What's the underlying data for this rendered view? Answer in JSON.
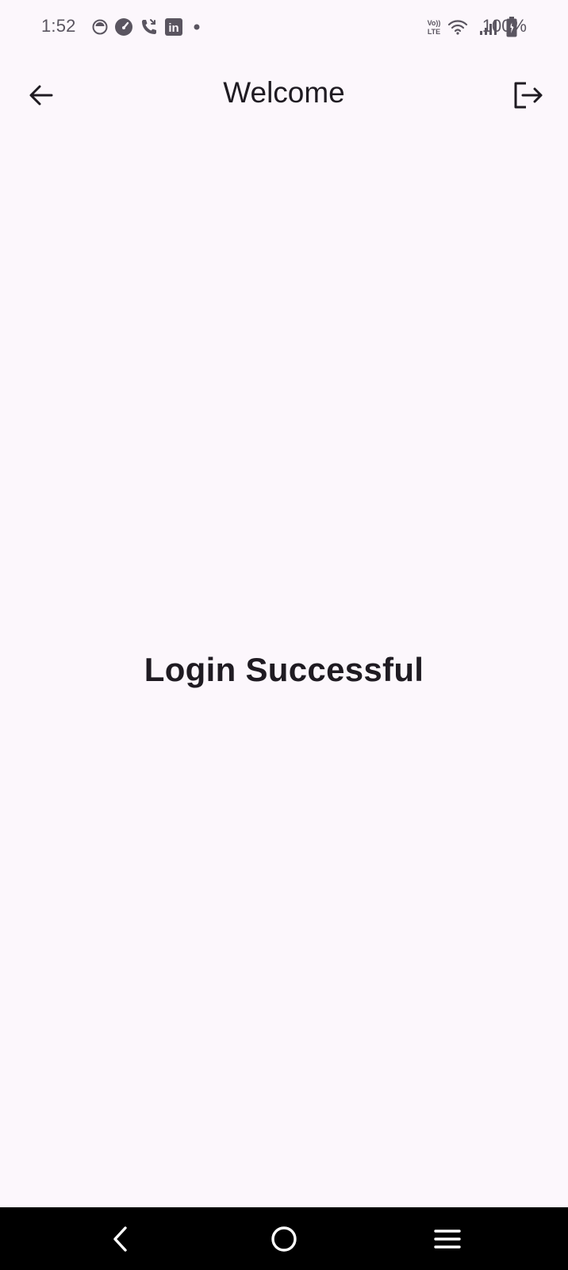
{
  "status_bar": {
    "time": "1:52",
    "battery_text": "100%",
    "left_icons": [
      "record-icon",
      "speedometer-icon",
      "missed-call-icon",
      "linkedin-icon",
      "notification-dot-icon"
    ],
    "right_icons": [
      "volte-icon",
      "wifi-icon",
      "signal-icon",
      "battery-charging-icon"
    ],
    "volte_label_top": "Vo))",
    "volte_label_bottom": "LTE",
    "linkedin_label": "in"
  },
  "app_bar": {
    "title": "Welcome",
    "back_icon": "arrow-back-icon",
    "logout_icon": "logout-icon"
  },
  "main": {
    "message": "Login Successful"
  },
  "nav_bar": {
    "back_icon": "nav-back-icon",
    "home_icon": "nav-home-icon",
    "recents_icon": "nav-recents-icon"
  },
  "colors": {
    "background": "#FCF7FC",
    "text": "#1F1B22",
    "status_text": "#5A5560",
    "nav_background": "#000000",
    "nav_icon": "#FFFFFF"
  }
}
